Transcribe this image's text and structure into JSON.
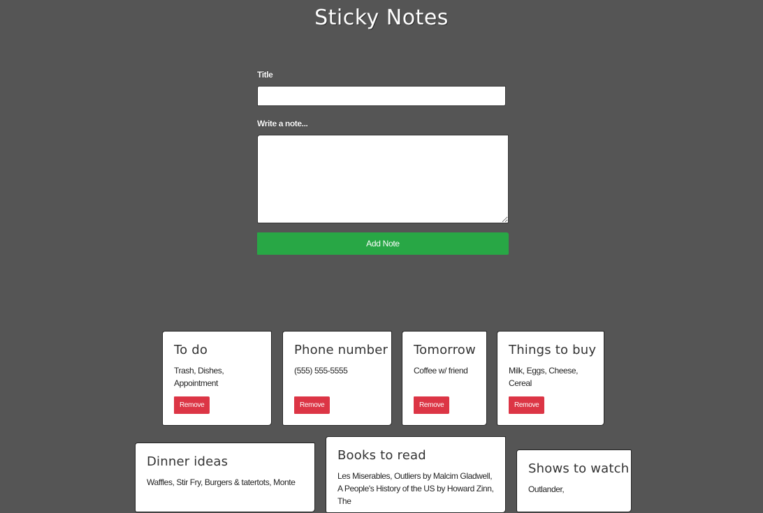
{
  "app": {
    "title": "Sticky Notes"
  },
  "form": {
    "title_label": "Title",
    "title_value": "",
    "note_label": "Write a note...",
    "note_value": "",
    "add_button_label": "Add Note"
  },
  "notes": [
    {
      "title": "To do",
      "text": "Trash, Dishes, Appointment",
      "remove_label": "Remove"
    },
    {
      "title": "Phone number",
      "text": "(555) 555-5555",
      "remove_label": "Remove"
    },
    {
      "title": "Tomorrow",
      "text": "Coffee w/ friend",
      "remove_label": "Remove"
    },
    {
      "title": "Things to buy",
      "text": "Milk, Eggs, Cheese, Cereal",
      "remove_label": "Remove"
    },
    {
      "title": "Dinner ideas",
      "text": "Waffles, Stir Fry, Burgers & tatertots, Monte",
      "remove_label": ""
    },
    {
      "title": "Books to read",
      "text": "Les Miserables, Outliers by Malcim Gladwell, A People's History of the US by Howard Zinn, The",
      "remove_label": ""
    },
    {
      "title": "Shows to watch",
      "text": "Outlander,",
      "remove_label": ""
    }
  ],
  "colors": {
    "background": "#555555",
    "add_button": "#28a745",
    "remove_button": "#dc3545",
    "card": "#ffffff"
  }
}
